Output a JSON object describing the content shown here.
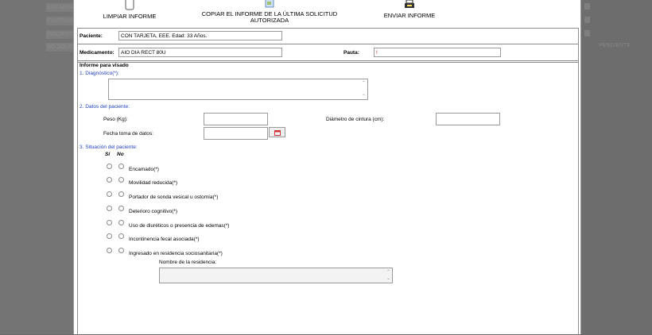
{
  "background": {
    "left_rows": [
      "ENCARGADO",
      "CAPTURA",
      "INSCRIPCIÓN",
      "NO SOLICITADO"
    ],
    "right_ghost": "PENDIENTE"
  },
  "toolbar": {
    "clear_label": "LIMPIAR INFORME",
    "copy_label": "COPIAR EL INFORME DE LA ÚLTIMA SOLICITUD AUTORIZADA",
    "send_label": "ENVIAR INFORME"
  },
  "patient": {
    "label": "Paciente:",
    "value": "CON TARJETA, EEE. Edad: 33 Años."
  },
  "medication": {
    "label": "Medicamento:",
    "value": "AIO DIA RECT 80U",
    "pauta_label": "Pauta:",
    "pauta_value": "!"
  },
  "report": {
    "title": "Informe para visado",
    "diagnosis_heading": "1. Diagnóstico(*):",
    "diagnosis_value": "",
    "patient_data_heading": "2. Datos del paciente:",
    "weight_label": "Peso (Kg):",
    "waist_label": "Diámetro de cintura (cm):",
    "date_label": "Fecha toma de datos:",
    "situation_heading": "3. Situación del paciente:",
    "yes_label": "Sí",
    "no_label": "No",
    "situations": [
      "Encamado(*)",
      "Movilidad reducida(*)",
      "Portador de sonda vesical u ostomía(*)",
      "Deterioro cognitivo(*)",
      "Uso de diuréticos o presencia de edemas(*)",
      "Incontinencia fecal asociada(*)",
      "Ingresado en residencia sociosanitaria(*)"
    ],
    "residence_label": "Nombre de la residencia:",
    "residence_value": ""
  },
  "colors": {
    "section_heading": "#1f3fbf",
    "pauta_mark": "#d00000"
  }
}
